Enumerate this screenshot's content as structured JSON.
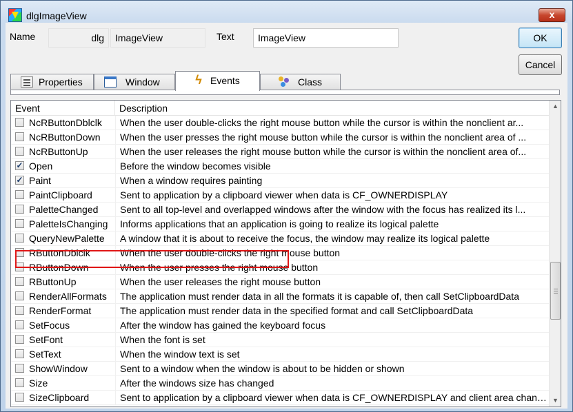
{
  "window": {
    "title": "dlgImageView",
    "close_label": "x"
  },
  "form": {
    "name_label": "Name",
    "name_prefix": "dlg",
    "name_value": "ImageView",
    "text_label": "Text",
    "text_value": "ImageView"
  },
  "buttons": {
    "ok": "OK",
    "cancel": "Cancel"
  },
  "tabs": [
    {
      "label": "Properties",
      "icon": "properties-icon"
    },
    {
      "label": "Window",
      "icon": "window-icon"
    },
    {
      "label": "Events",
      "icon": "lightning-icon",
      "active": true
    },
    {
      "label": "Class",
      "icon": "class-icon"
    }
  ],
  "grid": {
    "headers": [
      "Event",
      "Description"
    ],
    "highlight_color": "#e01616",
    "rows": [
      {
        "event": "NcRButtonDblclk",
        "checked": false,
        "description": "When the user double-clicks the right mouse button while the cursor is within the nonclient ar..."
      },
      {
        "event": "NcRButtonDown",
        "checked": false,
        "description": "When the user presses the right mouse button while the cursor is within the nonclient area of ..."
      },
      {
        "event": "NcRButtonUp",
        "checked": false,
        "description": "When the user releases the right mouse button while the cursor is within the nonclient area of..."
      },
      {
        "event": "Open",
        "checked": true,
        "description": "Before the window becomes visible"
      },
      {
        "event": "Paint",
        "checked": true,
        "description": "When a window requires painting"
      },
      {
        "event": "PaintClipboard",
        "checked": false,
        "description": "Sent to application by a clipboard viewer when data is CF_OWNERDISPLAY"
      },
      {
        "event": "PaletteChanged",
        "checked": false,
        "description": "Sent to all top-level and overlapped windows after the window with the focus has realized its l..."
      },
      {
        "event": "PaletteIsChanging",
        "checked": false,
        "description": "Informs applications that an application is going to realize its logical palette"
      },
      {
        "event": "QueryNewPalette",
        "checked": false,
        "description": "A window that it is about to receive the focus, the window may realize its logical palette"
      },
      {
        "event": "RButtonDblclk",
        "checked": false,
        "description": "When the user double-clicks the right mouse button"
      },
      {
        "event": "RButtonDown",
        "checked": false,
        "description": "When the user presses the right mouse button"
      },
      {
        "event": "RButtonUp",
        "checked": false,
        "description": "When the user releases the right mouse button"
      },
      {
        "event": "RenderAllFormats",
        "checked": false,
        "description": "The application must render data in all the formats it is capable of, then call SetClipboardData"
      },
      {
        "event": "RenderFormat",
        "checked": false,
        "description": "The application must render data in the specified format and call SetClipboardData"
      },
      {
        "event": "SetFocus",
        "checked": false,
        "description": "After the window has gained the keyboard focus"
      },
      {
        "event": "SetFont",
        "checked": false,
        "description": "When the font is set"
      },
      {
        "event": "SetText",
        "checked": false,
        "description": "When the window text is set"
      },
      {
        "event": "ShowWindow",
        "checked": false,
        "description": "Sent to a window when the window is about to be hidden or shown"
      },
      {
        "event": "Size",
        "checked": false,
        "description": "After the windows size has changed"
      },
      {
        "event": "SizeClipboard",
        "checked": false,
        "description": "Sent to application by a clipboard viewer when data is CF_OWNERDISPLAY and client area changed"
      }
    ]
  },
  "scrollbar": {
    "up": "▲",
    "down": "▼"
  }
}
